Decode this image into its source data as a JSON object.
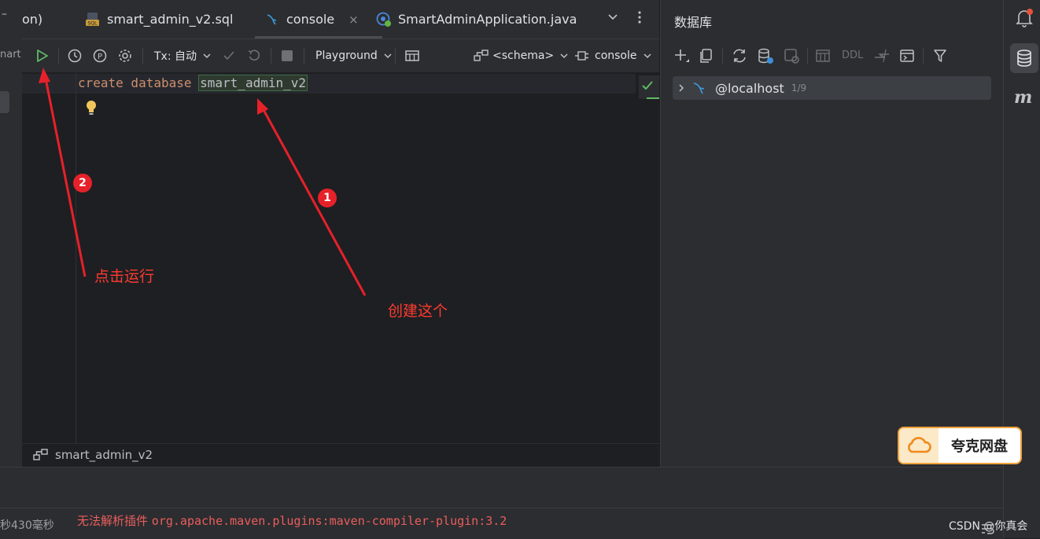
{
  "tabs": [
    {
      "label": "on)"
    },
    {
      "label": "smart_admin_v2.sql"
    },
    {
      "label": "console",
      "close": "×"
    },
    {
      "label": "SmartAdminApplication.java"
    }
  ],
  "left_strip": {
    "truncated_label": "nart"
  },
  "toolbar": {
    "tx_label": "Tx: 自动",
    "playground_label": "Playground",
    "schema_label": "<schema>",
    "session_label": "console"
  },
  "editor": {
    "keywords": "create database",
    "identifier": "smart_admin_v2"
  },
  "editor_footer": {
    "schema_name": "smart_admin_v2"
  },
  "db_panel": {
    "title": "数据库",
    "toolbar_ddl": "DDL",
    "datasource": {
      "name": "@localhost",
      "count": "1/9"
    }
  },
  "status": {
    "time": "秒430毫秒",
    "error_prefix": "无法解析插件",
    "error_plugin": "org.apache.maven.plugins:maven-compiler-plugin:3.2"
  },
  "annotations": {
    "badge_1": "1",
    "badge_2": "2",
    "label_1": "创建这个",
    "label_2": "点击运行"
  },
  "overlay": {
    "quark_label": "夸克网盘",
    "watermark": "CSDN @你真会"
  }
}
